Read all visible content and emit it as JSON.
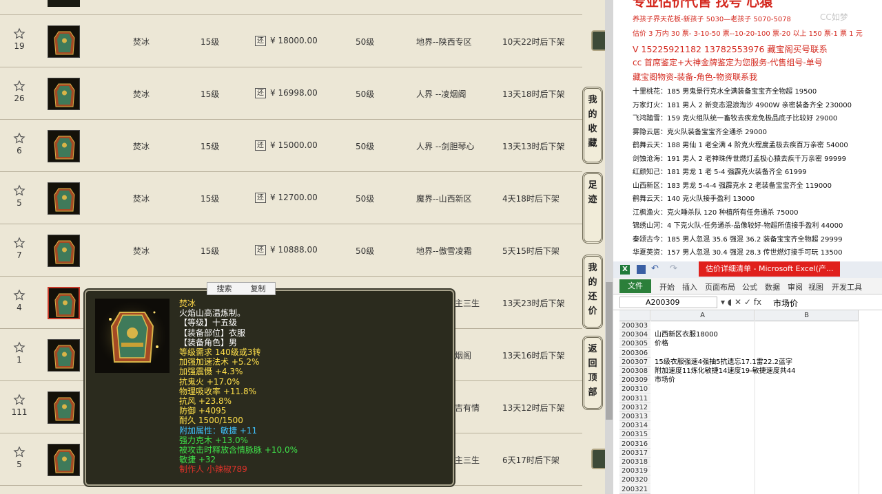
{
  "listing": {
    "rows": [
      {
        "fav_count": "19",
        "name": "焚冰",
        "level": "15级",
        "price_tag": "还",
        "price": "¥ 18000.00",
        "req_level": "50级",
        "server": "地界--陕西专区",
        "time": "10天22时后下架"
      },
      {
        "fav_count": "26",
        "name": "焚冰",
        "level": "15级",
        "price_tag": "还",
        "price": "¥ 16998.00",
        "req_level": "50级",
        "server": "人界 --凌烟阁",
        "time": "13天18时后下架"
      },
      {
        "fav_count": "6",
        "name": "焚冰",
        "level": "15级",
        "price_tag": "还",
        "price": "¥ 15000.00",
        "req_level": "50级",
        "server": "人界 --剑胆琴心",
        "time": "13天13时后下架"
      },
      {
        "fav_count": "5",
        "name": "焚冰",
        "level": "15级",
        "price_tag": "还",
        "price": "¥ 12700.00",
        "req_level": "50级",
        "server": "魔界--山西新区",
        "time": "4天18时后下架"
      },
      {
        "fav_count": "7",
        "name": "焚冰",
        "level": "15级",
        "price_tag": "还",
        "price": "¥ 10888.00",
        "req_level": "50级",
        "server": "地界--傲雪凌霜",
        "time": "5天15时后下架"
      },
      {
        "fav_count": "4",
        "name": "",
        "level": "",
        "price_tag": "",
        "price": "",
        "req_level": "",
        "server": "主三生",
        "time": "13天23时后下架"
      },
      {
        "fav_count": "1",
        "name": "",
        "level": "",
        "price_tag": "",
        "price": "",
        "req_level": "",
        "server": "烟阁",
        "time": "13天16时后下架"
      },
      {
        "fav_count": "111",
        "name": "",
        "level": "",
        "price_tag": "",
        "price": "",
        "req_level": "",
        "server": "吉有情",
        "time": "13天12时后下架"
      },
      {
        "fav_count": "5",
        "name": "",
        "level": "",
        "price_tag": "",
        "price": "",
        "req_level": "",
        "server": "主三生",
        "time": "6天17时后下架"
      }
    ]
  },
  "side_buttons": {
    "favorites": "我的收藏",
    "footprints": "足迹",
    "my_offers": "我的还价",
    "back_to_top": "返回顶部"
  },
  "context_menu": {
    "search": "搜索",
    "copy": "复制"
  },
  "tooltip": {
    "lines": [
      {
        "text": "焚冰",
        "color": "#ffd84a"
      },
      {
        "text": "火焰山高温炼制。",
        "color": "#ffffff"
      },
      {
        "text": "【等级】十五级",
        "color": "#ffffff"
      },
      {
        "text": "【装备部位】衣服",
        "color": "#ffffff"
      },
      {
        "text": "【装备角色】男",
        "color": "#ffffff"
      },
      {
        "text": "等级需求 140级或3转",
        "color": "#ffe04a"
      },
      {
        "text": "加强加速法术 +5.2%",
        "color": "#ffe04a"
      },
      {
        "text": "加强震慑 +4.3%",
        "color": "#ffe04a"
      },
      {
        "text": "抗鬼火 +17.0%",
        "color": "#ffe04a"
      },
      {
        "text": "物理吸收率 +11.8%",
        "color": "#ffe04a"
      },
      {
        "text": "抗风 +23.8%",
        "color": "#ffe04a"
      },
      {
        "text": "防御 +4095",
        "color": "#ffe04a"
      },
      {
        "text": "耐久 1500/1500",
        "color": "#ffe04a"
      },
      {
        "text": "附加属性：敏捷 +11",
        "color": "#3fc3ff"
      },
      {
        "text": "强力克木 +13.0%",
        "color": "#3fe04a"
      },
      {
        "text": "被攻击时释放含情脉脉 +10.0%",
        "color": "#3fe04a"
      },
      {
        "text": "敏捷 +32",
        "color": "#3fe04a"
      },
      {
        "text": "制作人 小辣椒789",
        "color": "#e0322a"
      }
    ]
  },
  "notes": {
    "header": "专业估价代售 找号 心猿",
    "watermark": "CC如梦",
    "lines": [
      {
        "text": "养孩子界天花板-新孩子 5030—老孩子 5070-5078",
        "color": "#d4281e",
        "size": 10
      },
      {
        "text": "估价 3 万内 30 票- 3-10-50 票--10-20-100 票-20 以上 150 票-1 票 1 元",
        "color": "#d4281e",
        "size": 10
      },
      {
        "text": "V 15225921182      13782553976    藏宝阁买号联系",
        "color": "#d4281e",
        "size": 12.5
      },
      {
        "text": "cc 首席鉴定+大神金牌鉴定为您服务-代售组号-单号",
        "color": "#d4281e",
        "size": 12
      },
      {
        "text": "藏宝阁物资-装备-角色-物资联系我",
        "color": "#d4281e",
        "size": 12
      },
      {
        "text": "十里桃花：185 男鬼景行克水全满装备宝宝齐全物超 19500",
        "color": "#111111",
        "size": 10
      },
      {
        "text": "万家灯火：181 男人 2 新变态混浪淘沙 4900W 亲密装备齐全 230000",
        "color": "#111111",
        "size": 10
      },
      {
        "text": "飞鸿踏雪：159 克火组队统一畜牧去疾龙免极品底子比较好 29000",
        "color": "#111111",
        "size": 10
      },
      {
        "text": "雾隐云居：克火队装备宝宝齐全通杀 29000",
        "color": "#111111",
        "size": 10
      },
      {
        "text": "鹤舞云天：188 男仙 1 老全满 4 阶克火程度孟极去疾百万亲密 54000",
        "color": "#111111",
        "size": 10
      },
      {
        "text": "剑蚀沧海：191 男人 2 老神珠传世燃灯孟极心猿去疾千万亲密 99999",
        "color": "#111111",
        "size": 10
      },
      {
        "text": "红颜知己：181 男龙 1 老 5-4 强霹克火装备齐全 61999",
        "color": "#111111",
        "size": 10
      },
      {
        "text": "山西新区：183 男龙 5-4-4 强霹克水 2 老装备宝宝齐全 119000",
        "color": "#111111",
        "size": 10
      },
      {
        "text": "鹤舞云天：140 克火队接手盈利 13000",
        "color": "#111111",
        "size": 10
      },
      {
        "text": "江枫渔火：克火睡杀队 120 种植所有任务通杀 75000",
        "color": "#111111",
        "size": 10
      },
      {
        "text": "锦绣山河：4 下克火队-任务通杀-品像较好-物超所值接手盈利 44000",
        "color": "#111111",
        "size": 10
      },
      {
        "text": "秦颂古今：185 男人忽混 35.6 强混 36.2 装备宝宝齐全物超 29999",
        "color": "#111111",
        "size": 10
      },
      {
        "text": "华夏英资：157 男人忽混 30.4 强混 28.3 传世燃灯接手可玩 13500",
        "color": "#111111",
        "size": 10
      }
    ]
  },
  "excel": {
    "title": "估价详细清单 - Microsoft Excel(产...",
    "tabs": [
      "文件",
      "开始",
      "插入",
      "页面布局",
      "公式",
      "数据",
      "审阅",
      "视图",
      "开发工具"
    ],
    "name_box": "A200309",
    "formula_value": "市场价",
    "col_a": "A",
    "col_b": "B",
    "rows": [
      {
        "num": "200303",
        "a": ""
      },
      {
        "num": "200304",
        "a": "山西新区衣服18000"
      },
      {
        "num": "200305",
        "a": "价格"
      },
      {
        "num": "200306",
        "a": ""
      },
      {
        "num": "200307",
        "a": "15级衣服强速4强抽5抗遗忘17.1雷22.2蓝字"
      },
      {
        "num": "200308",
        "a": "附加速度11炼化敏捷14速度19-敏捷速度共44"
      },
      {
        "num": "200309",
        "a": "市场价"
      },
      {
        "num": "200310",
        "a": ""
      },
      {
        "num": "200311",
        "a": ""
      },
      {
        "num": "200312",
        "a": ""
      },
      {
        "num": "200313",
        "a": ""
      },
      {
        "num": "200314",
        "a": ""
      },
      {
        "num": "200315",
        "a": ""
      },
      {
        "num": "200316",
        "a": ""
      },
      {
        "num": "200317",
        "a": ""
      },
      {
        "num": "200318",
        "a": ""
      },
      {
        "num": "200319",
        "a": ""
      },
      {
        "num": "200320",
        "a": ""
      },
      {
        "num": "200321",
        "a": ""
      }
    ]
  }
}
